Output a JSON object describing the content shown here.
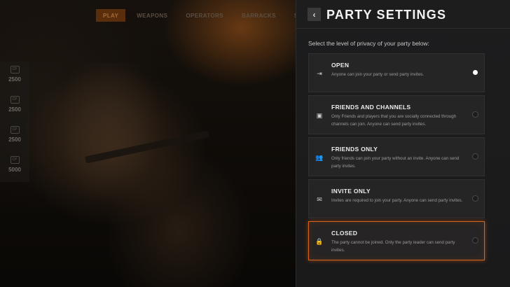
{
  "nav": {
    "tabs": [
      {
        "label": "PLAY",
        "active": true
      },
      {
        "label": "WEAPONS",
        "active": false
      },
      {
        "label": "OPERATORS",
        "active": false
      },
      {
        "label": "BARRACKS",
        "active": false
      },
      {
        "label": "STORE",
        "active": false
      }
    ]
  },
  "currency": {
    "items": [
      {
        "icon": "cp-coin-icon",
        "glyph": "CP",
        "amount": "2500"
      },
      {
        "icon": "cp-coin-icon",
        "glyph": "CP",
        "amount": "2500"
      },
      {
        "icon": "cp-coin-icon",
        "glyph": "CP",
        "amount": "2500"
      },
      {
        "icon": "cp-coin-icon",
        "glyph": "CP",
        "amount": "5000"
      }
    ]
  },
  "panel": {
    "back_glyph": "‹",
    "title": "PARTY SETTINGS",
    "subtitle": "Select the level of privacy of your party below:",
    "selected_index": 0,
    "focused_index": 4,
    "options": [
      {
        "name": "OPEN",
        "description": "Anyone can join your party or send party invites.",
        "icon": "enter-icon",
        "glyph": "⇥"
      },
      {
        "name": "FRIENDS AND CHANNELS",
        "description": "Only Friends and players that you are socially connected through channels can join. Anyone can send party invites.",
        "icon": "channels-icon",
        "glyph": "▣"
      },
      {
        "name": "FRIENDS ONLY",
        "description": "Only friends can join your party without an invite. Anyone can send party invites.",
        "icon": "friends-icon",
        "glyph": "👥"
      },
      {
        "name": "INVITE ONLY",
        "description": "Invites are required to join your party. Anyone can send party invites.",
        "icon": "envelope-icon",
        "glyph": "✉"
      },
      {
        "name": "CLOSED",
        "description": "The party cannot be joined. Only the party leader can send party invites.",
        "icon": "lock-icon",
        "glyph": "🔒"
      }
    ]
  },
  "colors": {
    "accent": "#d8641c",
    "panel_bg": "#1d1d1e",
    "option_bg": "#252526",
    "tab_active_bg": "#5a2e0c"
  }
}
